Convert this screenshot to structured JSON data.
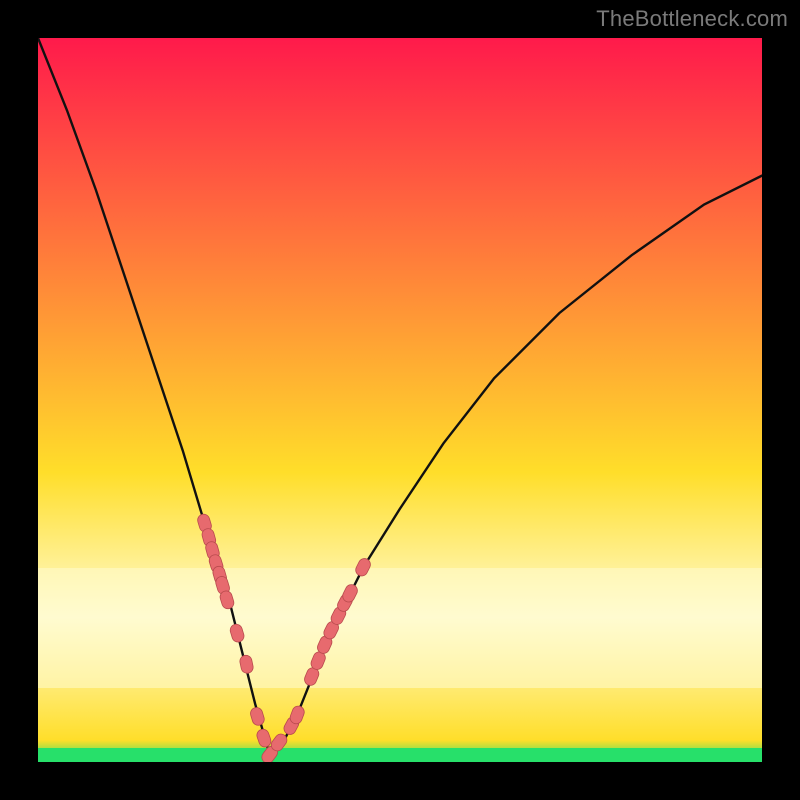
{
  "watermark": "TheBottleneck.com",
  "colors": {
    "frame_bg": "#000000",
    "grad_top": "#ff1a4b",
    "grad_mid": "#ffde2a",
    "grad_bottom": "#27e06a",
    "pale_band": "#fffbd0",
    "curve": "#111111",
    "marker_fill": "#e76a6e",
    "marker_stroke": "#b94a4d"
  },
  "chart_data": {
    "type": "line",
    "title": "",
    "xlabel": "",
    "ylabel": "",
    "x_range": [
      0,
      100
    ],
    "y_range": [
      0,
      100
    ],
    "vertex_x": 32,
    "series": [
      {
        "name": "bottleneck-curve",
        "x": [
          0,
          4,
          8,
          12,
          16,
          20,
          23,
          26,
          28,
          30,
          32,
          34,
          36,
          38,
          41,
          45,
          50,
          56,
          63,
          72,
          82,
          92,
          100
        ],
        "y": [
          100,
          90,
          79,
          67,
          55,
          43,
          33,
          24,
          16,
          8,
          1,
          3,
          7,
          12,
          19,
          27,
          35,
          44,
          53,
          62,
          70,
          77,
          81
        ]
      }
    ],
    "markers": {
      "name": "highlight-beads",
      "x": [
        23.0,
        23.6,
        24.1,
        24.6,
        25.1,
        25.5,
        26.1,
        27.5,
        28.8,
        30.3,
        31.2,
        32.0,
        33.3,
        35.0,
        35.8,
        37.8,
        38.7,
        39.6,
        40.5,
        41.5,
        42.4,
        43.1,
        44.9
      ],
      "y": [
        33.0,
        31.0,
        29.2,
        27.4,
        25.8,
        24.4,
        22.4,
        17.8,
        13.5,
        6.3,
        3.3,
        1.0,
        2.7,
        5.0,
        6.5,
        11.8,
        14.0,
        16.2,
        18.2,
        20.2,
        22.0,
        23.3,
        26.9
      ]
    }
  }
}
